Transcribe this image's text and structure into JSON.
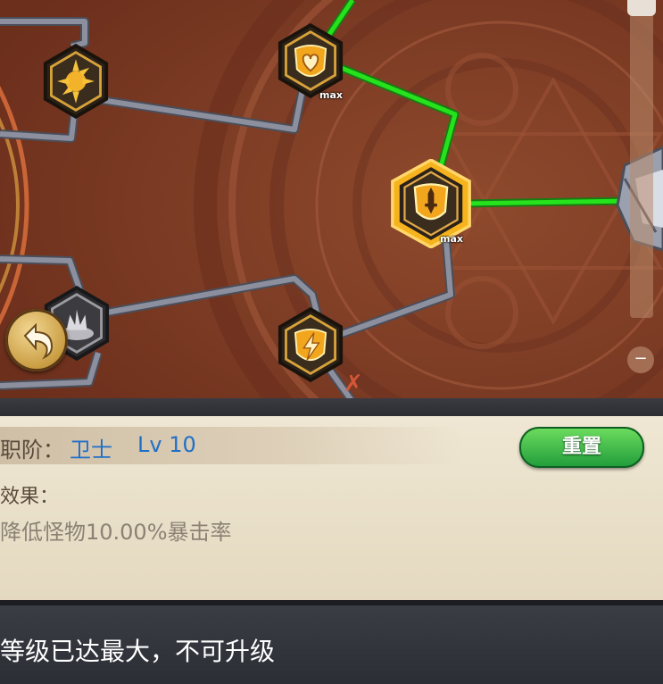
{
  "tree": {
    "nodes": [
      {
        "id": "sun-burst",
        "icon": "sun-burst-icon",
        "state": "unlocked",
        "max": false
      },
      {
        "id": "heart-shield",
        "icon": "heart-icon",
        "state": "unlocked",
        "max": true
      },
      {
        "id": "sword-shield",
        "icon": "sword-icon",
        "state": "selected",
        "max": true
      },
      {
        "id": "grey-skill",
        "icon": "explosion-icon",
        "state": "locked",
        "max": false
      },
      {
        "id": "lightning-shield",
        "icon": "lightning-icon",
        "state": "unlocked",
        "max": false
      }
    ],
    "max_label": "max",
    "colors": {
      "active_link": "#25e21c",
      "inactive_link": "#8c8f9e",
      "gold": "#f4a11a",
      "bg": "#7d3a23"
    }
  },
  "controls": {
    "back_icon": "back-arrow-icon",
    "zoom_out_label": "−"
  },
  "panel": {
    "rank_label": "职阶：",
    "rank_value": "卫士",
    "level_label": "Lv 10",
    "reset_label": "重置",
    "effect_label": "效果：",
    "effect_text": "降低怪物10.00%暴击率"
  },
  "notice": {
    "text": "等级已达最大，不可升级"
  }
}
